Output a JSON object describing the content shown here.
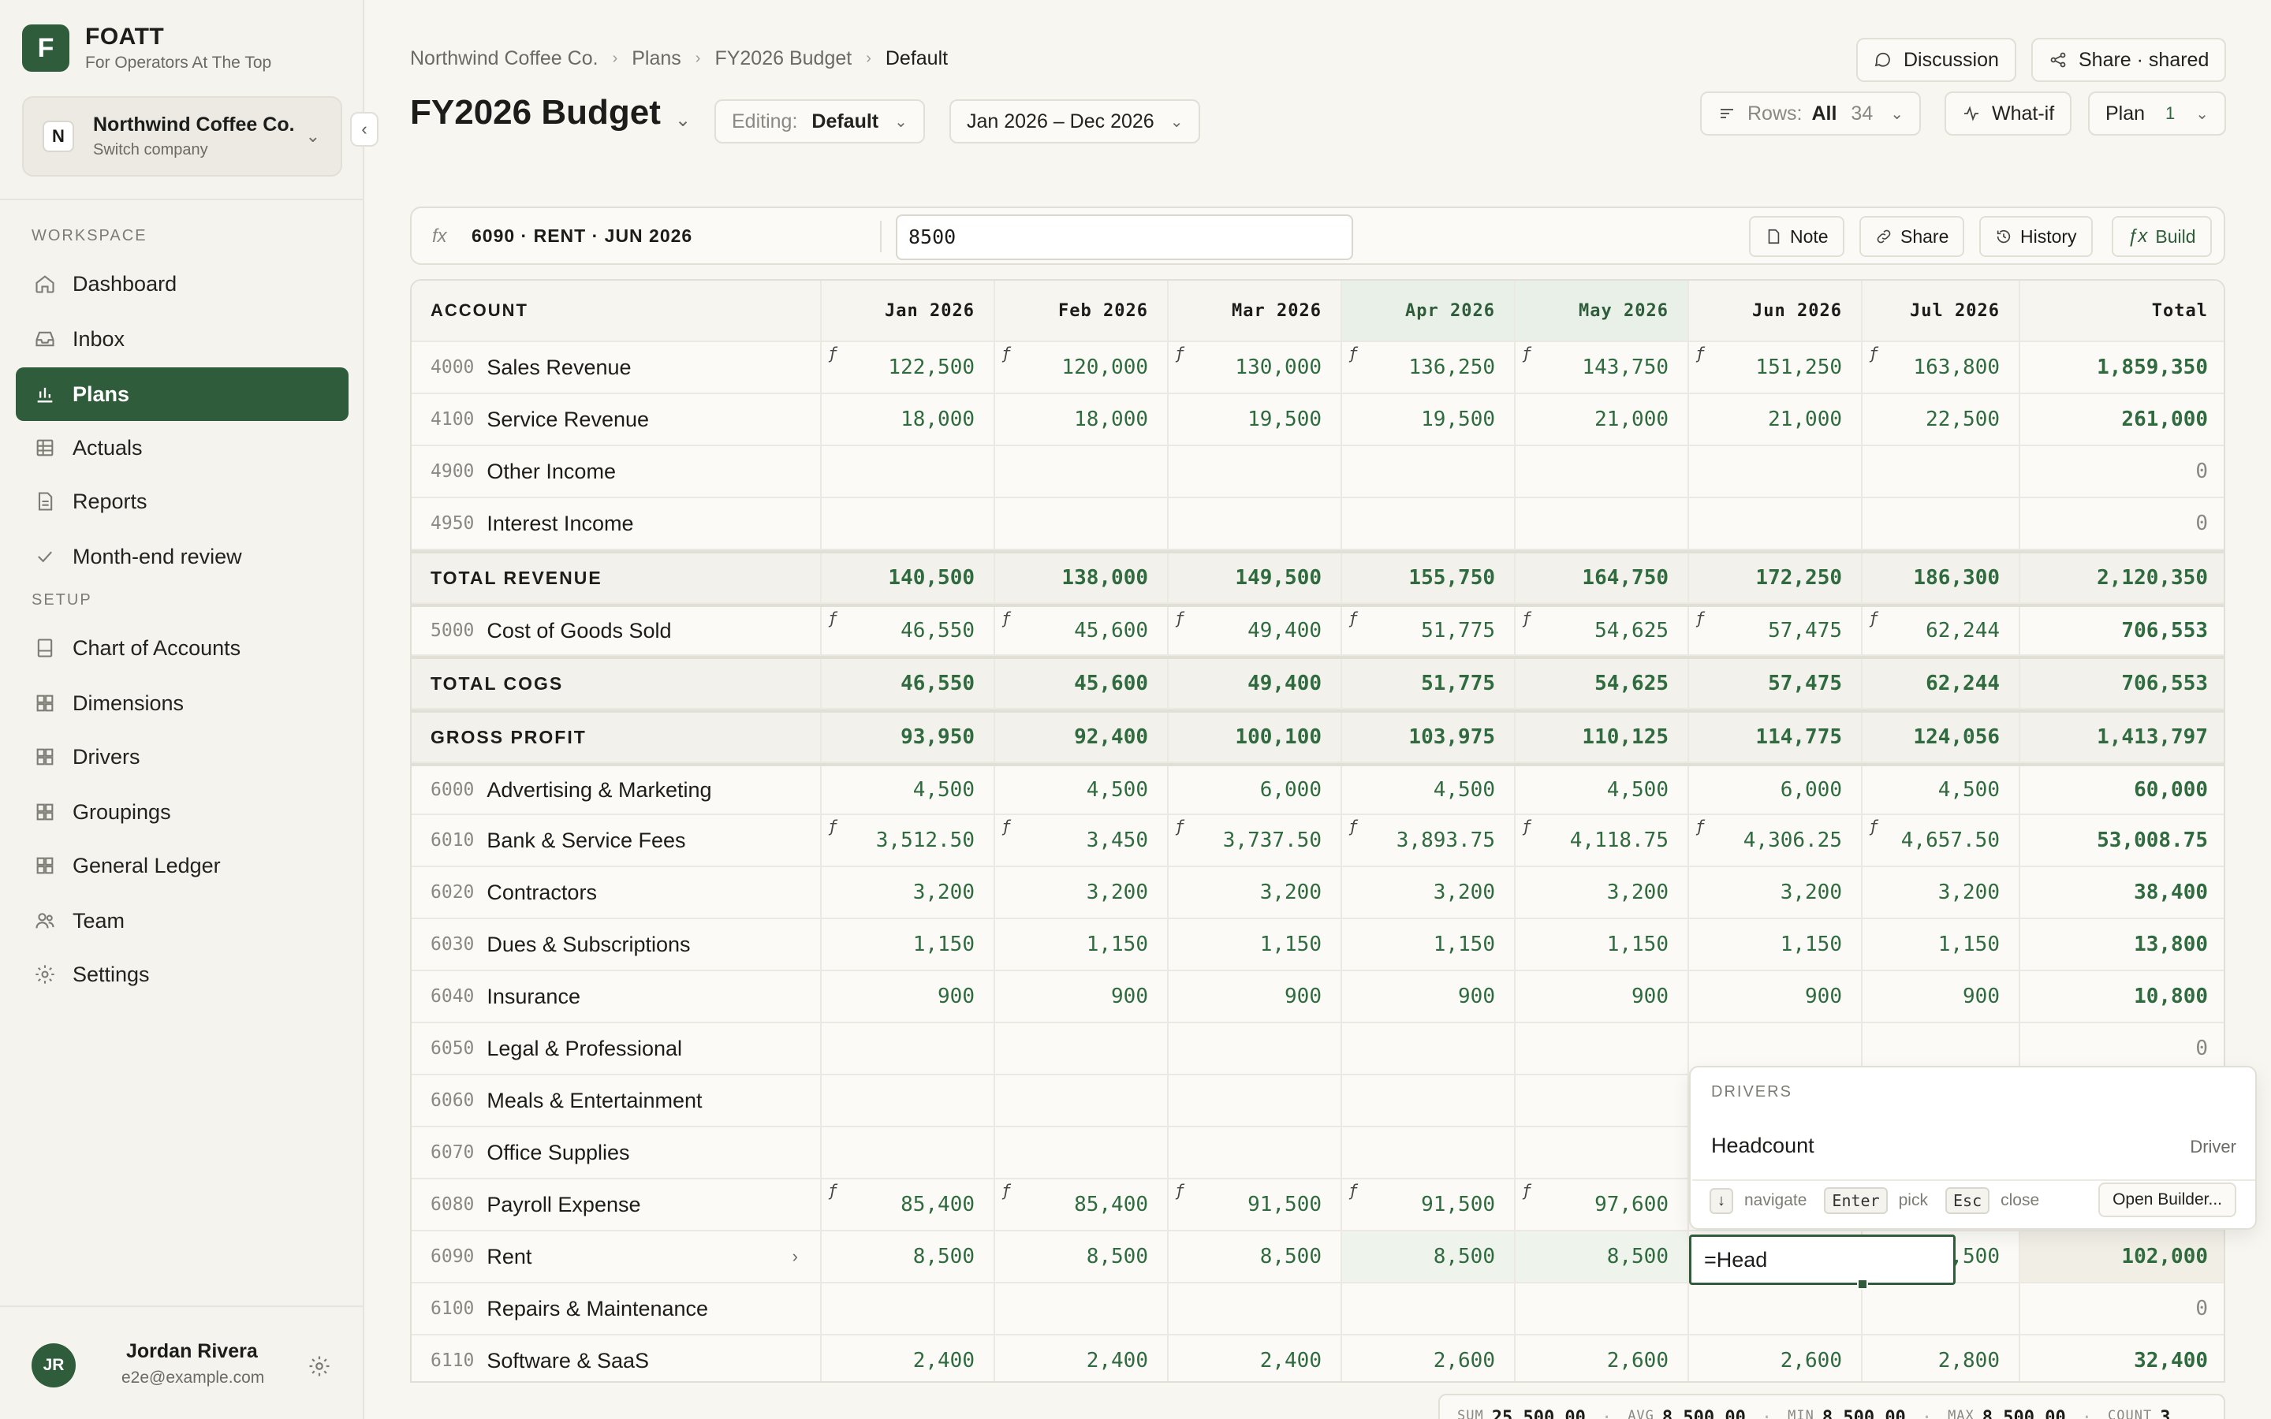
{
  "brand": {
    "logo": "F",
    "name": "FOATT",
    "tagline": "For Operators At The Top"
  },
  "company": {
    "badge": "N",
    "name": "Northwind Coffee Co.",
    "sub": "Switch company"
  },
  "sidebar": {
    "workspace_label": "WORKSPACE",
    "setup_label": "SETUP",
    "workspace": [
      {
        "label": "Dashboard",
        "icon": "home-icon"
      },
      {
        "label": "Inbox",
        "icon": "inbox-icon"
      },
      {
        "label": "Plans",
        "icon": "bar-chart-icon",
        "active": true
      },
      {
        "label": "Actuals",
        "icon": "table-icon"
      },
      {
        "label": "Reports",
        "icon": "document-icon"
      },
      {
        "label": "Month-end review",
        "icon": "check-icon"
      }
    ],
    "setup": [
      {
        "label": "Chart of Accounts",
        "icon": "ledger-icon"
      },
      {
        "label": "Dimensions",
        "icon": "grid-icon"
      },
      {
        "label": "Drivers",
        "icon": "grid-icon"
      },
      {
        "label": "Groupings",
        "icon": "grid-icon"
      },
      {
        "label": "General Ledger",
        "icon": "grid-icon"
      },
      {
        "label": "Team",
        "icon": "users-icon"
      },
      {
        "label": "Settings",
        "icon": "gear-icon"
      }
    ]
  },
  "user": {
    "initials": "JR",
    "name": "Jordan Rivera",
    "email": "e2e@example.com"
  },
  "breadcrumb": [
    "Northwind Coffee Co.",
    "Plans",
    "FY2026 Budget",
    "Default"
  ],
  "header": {
    "title": "FY2026 Budget",
    "editing_label": "Editing:",
    "editing_value": "Default",
    "range": "Jan 2026 – Dec 2026",
    "discussion": "Discussion",
    "share": "Share · shared",
    "rows_label": "Rows:",
    "rows_value": "All",
    "rows_count": "34",
    "whatif": "What-if",
    "plan": "Plan",
    "plan_count": "1"
  },
  "formula_bar": {
    "fx": "fx",
    "cell_ref": "6090 · RENT · JUN 2026",
    "value": "8500",
    "note": "Note",
    "share": "Share",
    "history": "History",
    "build": "Build"
  },
  "grid": {
    "columns": [
      "ACCOUNT",
      "Jan 2026",
      "Feb 2026",
      "Mar 2026",
      "Apr 2026",
      "May 2026",
      "Jun 2026",
      "Jul 2026",
      "Total"
    ],
    "rows": [
      {
        "code": "4000",
        "name": "Sales Revenue",
        "formula": true,
        "values": [
          "122,500",
          "120,000",
          "130,000",
          "136,250",
          "143,750",
          "151,250",
          "163,800"
        ],
        "total": "1,859,350"
      },
      {
        "code": "4100",
        "name": "Service Revenue",
        "values": [
          "18,000",
          "18,000",
          "19,500",
          "19,500",
          "21,000",
          "21,000",
          "22,500"
        ],
        "total": "261,000"
      },
      {
        "code": "4900",
        "name": "Other Income",
        "values": [
          "",
          "",
          "",
          "",
          "",
          "",
          ""
        ],
        "total": "0"
      },
      {
        "code": "4950",
        "name": "Interest Income",
        "values": [
          "",
          "",
          "",
          "",
          "",
          "",
          ""
        ],
        "total": "0"
      },
      {
        "summary": true,
        "name": "TOTAL REVENUE",
        "values": [
          "140,500",
          "138,000",
          "149,500",
          "155,750",
          "164,750",
          "172,250",
          "186,300"
        ],
        "total": "2,120,350"
      },
      {
        "code": "5000",
        "name": "Cost of Goods Sold",
        "formula": true,
        "values": [
          "46,550",
          "45,600",
          "49,400",
          "51,775",
          "54,625",
          "57,475",
          "62,244"
        ],
        "total": "706,553"
      },
      {
        "summary": true,
        "name": "TOTAL COGS",
        "values": [
          "46,550",
          "45,600",
          "49,400",
          "51,775",
          "54,625",
          "57,475",
          "62,244"
        ],
        "total": "706,553"
      },
      {
        "summary": true,
        "name": "GROSS PROFIT",
        "values": [
          "93,950",
          "92,400",
          "100,100",
          "103,975",
          "110,125",
          "114,775",
          "124,056"
        ],
        "total": "1,413,797"
      },
      {
        "code": "6000",
        "name": "Advertising & Marketing",
        "values": [
          "4,500",
          "4,500",
          "6,000",
          "4,500",
          "4,500",
          "6,000",
          "4,500"
        ],
        "total": "60,000"
      },
      {
        "code": "6010",
        "name": "Bank & Service Fees",
        "formula": true,
        "values": [
          "3,512.50",
          "3,450",
          "3,737.50",
          "3,893.75",
          "4,118.75",
          "4,306.25",
          "4,657.50"
        ],
        "total": "53,008.75"
      },
      {
        "code": "6020",
        "name": "Contractors",
        "values": [
          "3,200",
          "3,200",
          "3,200",
          "3,200",
          "3,200",
          "3,200",
          "3,200"
        ],
        "total": "38,400"
      },
      {
        "code": "6030",
        "name": "Dues & Subscriptions",
        "values": [
          "1,150",
          "1,150",
          "1,150",
          "1,150",
          "1,150",
          "1,150",
          "1,150"
        ],
        "total": "13,800"
      },
      {
        "code": "6040",
        "name": "Insurance",
        "values": [
          "900",
          "900",
          "900",
          "900",
          "900",
          "900",
          "900"
        ],
        "total": "10,800"
      },
      {
        "code": "6050",
        "name": "Legal & Professional",
        "values": [
          "",
          "",
          "",
          "",
          "",
          "",
          ""
        ],
        "total": "0"
      },
      {
        "code": "6060",
        "name": "Meals & Entertainment",
        "values": [
          "",
          "",
          "",
          "",
          "",
          "",
          ""
        ],
        "total": ""
      },
      {
        "code": "6070",
        "name": "Office Supplies",
        "values": [
          "",
          "",
          "",
          "",
          "",
          "",
          ""
        ],
        "total": ""
      },
      {
        "code": "6080",
        "name": "Payroll Expense",
        "formula": true,
        "values": [
          "85,400",
          "85,400",
          "91,500",
          "91,500",
          "97,600",
          "",
          ""
        ],
        "total": ""
      },
      {
        "code": "6090",
        "name": "Rent",
        "rent": true,
        "values": [
          "8,500",
          "8,500",
          "8,500",
          "8,500",
          "8,500",
          "",
          "8,500"
        ],
        "total": "102,000"
      },
      {
        "code": "6100",
        "name": "Repairs & Maintenance",
        "values": [
          "",
          "",
          "",
          "",
          "",
          "",
          ""
        ],
        "total": "0"
      },
      {
        "code": "6110",
        "name": "Software & SaaS",
        "values": [
          "2,400",
          "2,400",
          "2,400",
          "2,600",
          "2,600",
          "2,600",
          "2,800"
        ],
        "total": "32,400"
      }
    ]
  },
  "editor": {
    "value": "=Head"
  },
  "dropdown": {
    "label": "DRIVERS",
    "item_name": "Headcount",
    "item_type": "Driver",
    "key_nav": "↓",
    "nav": "navigate",
    "key_pick": "Enter",
    "pick": "pick",
    "key_close": "Esc",
    "close": "close",
    "builder": "Open Builder..."
  },
  "status": {
    "sum_label": "SUM",
    "sum": "25,500.00",
    "avg_label": "AVG",
    "avg": "8,500.00",
    "min_label": "MIN",
    "min": "8,500.00",
    "max_label": "MAX",
    "max": "8,500.00",
    "count_label": "COUNT",
    "count": "3"
  },
  "colors": {
    "accent": "#2f5d3c",
    "value_green": "#2f6b3f",
    "background": "#f7f6f1"
  }
}
